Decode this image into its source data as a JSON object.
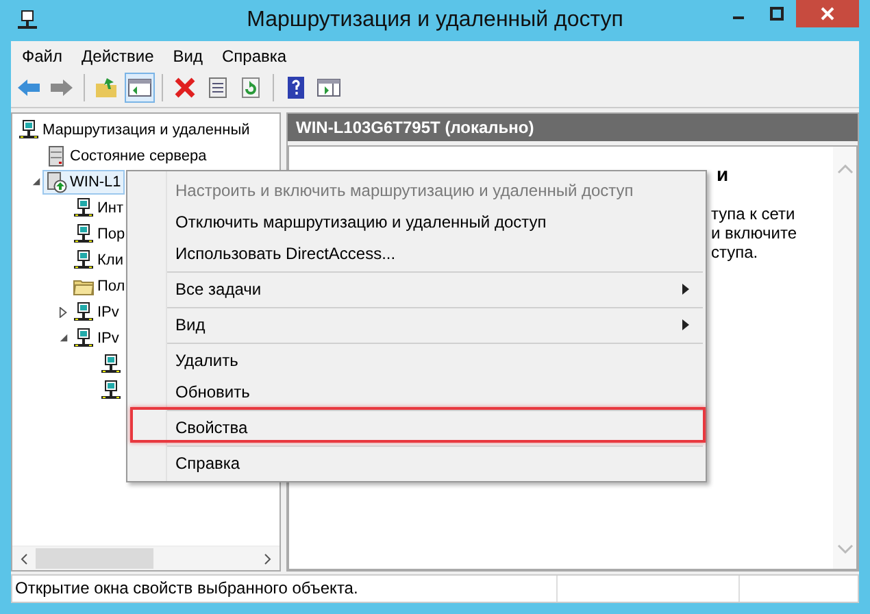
{
  "window": {
    "title": "Маршрутизация и удаленный доступ"
  },
  "menu_bar": [
    "Файл",
    "Действие",
    "Вид",
    "Справка"
  ],
  "toolbar": [
    {
      "kind": "back",
      "selected": false
    },
    {
      "kind": "forward",
      "selected": false
    },
    {
      "kind": "sep"
    },
    {
      "kind": "up",
      "selected": false
    },
    {
      "kind": "tree",
      "selected": true
    },
    {
      "kind": "sep"
    },
    {
      "kind": "delete",
      "selected": false
    },
    {
      "kind": "props",
      "selected": false
    },
    {
      "kind": "refresh",
      "selected": false
    },
    {
      "kind": "sep"
    },
    {
      "kind": "help",
      "selected": false
    },
    {
      "kind": "pane",
      "selected": false
    }
  ],
  "tree": [
    {
      "label": "Маршрутизация и удаленный",
      "kind": "computer",
      "selected": false,
      "children": [
        {
          "label": "Состояние сервера",
          "kind": "server",
          "selected": false
        },
        {
          "label": "WIN-L1",
          "kind": "server-up",
          "selected": true,
          "expanded": true,
          "children": [
            {
              "label": "Инт",
              "kind": "computer",
              "selected": false
            },
            {
              "label": "Пор",
              "kind": "computer",
              "selected": false
            },
            {
              "label": "Кли",
              "kind": "computer",
              "selected": false
            },
            {
              "label": "Пол",
              "kind": "folder",
              "selected": false
            },
            {
              "label": "IPv",
              "kind": "computer",
              "selected": false,
              "expanded": false
            },
            {
              "label": "IPv",
              "kind": "computer",
              "selected": false,
              "expanded": true,
              "children": [
                {
                  "kind": "computer",
                  "selected": false
                },
                {
                  "kind": "computer",
                  "selected": false
                }
              ]
            }
          ]
        }
      ]
    }
  ],
  "details": {
    "header": "WIN-L103G6T795T (локально)",
    "heading": "и",
    "lines": [
      "тупа к сети",
      "и включите",
      "ступа."
    ]
  },
  "context_menu": [
    {
      "label": "Настроить и включить маршрутизацию и удаленный доступ",
      "disabled": true,
      "submenu": false,
      "highlighted": false,
      "separator_before": false
    },
    {
      "label": "Отключить маршрутизацию и удаленный доступ",
      "disabled": false,
      "submenu": false,
      "highlighted": false,
      "separator_before": false
    },
    {
      "label": "Использовать DirectAccess...",
      "disabled": false,
      "submenu": false,
      "highlighted": false,
      "separator_before": false
    },
    {
      "label": "Все задачи",
      "disabled": false,
      "submenu": true,
      "highlighted": false,
      "separator_before": true
    },
    {
      "label": "Вид",
      "disabled": false,
      "submenu": true,
      "highlighted": false,
      "separator_before": true
    },
    {
      "label": "Удалить",
      "disabled": false,
      "submenu": false,
      "highlighted": false,
      "separator_before": true
    },
    {
      "label": "Обновить",
      "disabled": false,
      "submenu": false,
      "highlighted": false,
      "separator_before": false
    },
    {
      "label": "Свойства",
      "disabled": false,
      "submenu": false,
      "highlighted": true,
      "separator_before": true
    },
    {
      "label": "Справка",
      "disabled": false,
      "submenu": false,
      "highlighted": false,
      "separator_before": true
    }
  ],
  "status_bar": "Открытие окна свойств выбранного объекта."
}
